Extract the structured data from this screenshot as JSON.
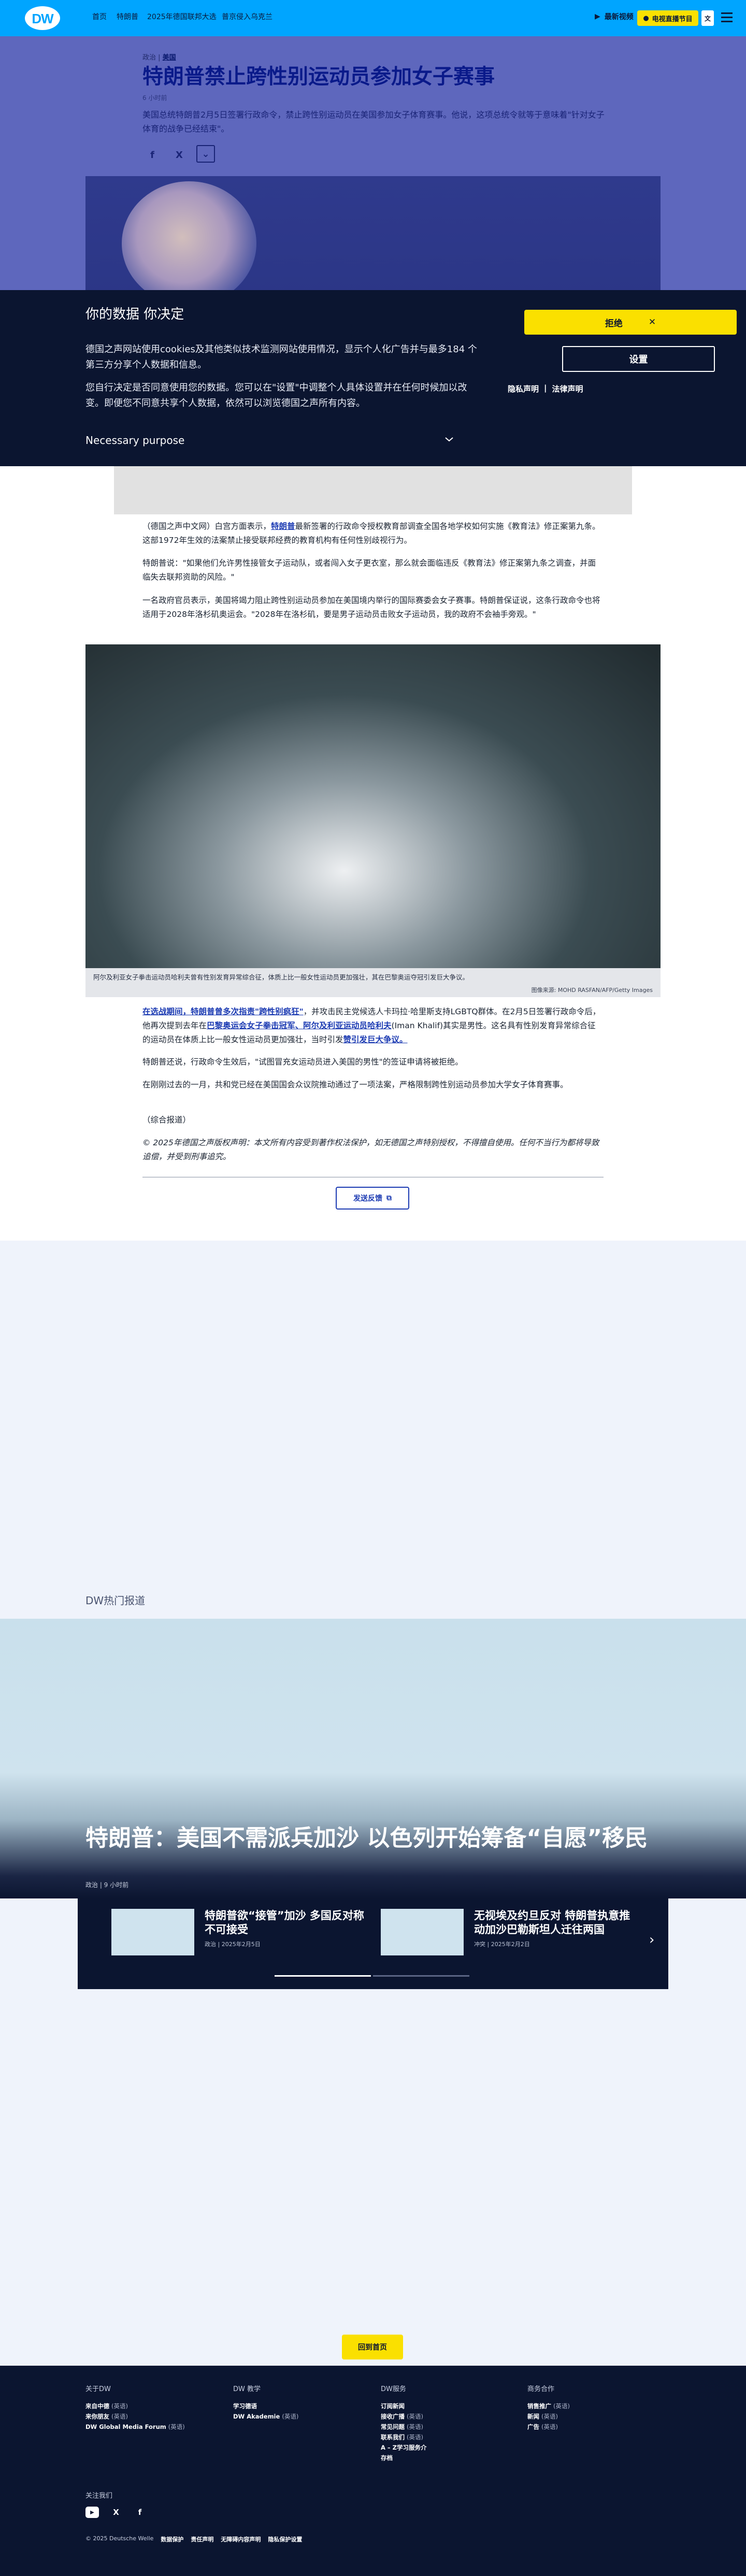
{
  "header": {
    "logo": "DW",
    "nav": [
      "首页",
      "特朗普",
      "2025年德国联邦大选",
      "普京侵入乌克兰"
    ],
    "latest": "最新视频",
    "live_label": "电视直播节目",
    "lang": "文"
  },
  "article": {
    "breadcrumb_prefix": "政治",
    "breadcrumb_section": "美国",
    "title": "特朗普禁止跨性别运动员参加女子赛事",
    "time": "6 小时前",
    "lead": "美国总统特朗普2月5日签署行政命令，禁止跨性别运动员在美国参加女子体育赛事。他说，这项总统令就等于意味着\"针对女子体育的战争已经结束\"。",
    "paragraphs": {
      "p1_a": "（德国之声中文网）白宫方面表示，",
      "p1_link": "特朗普",
      "p1_b": "最新签署的行政命令授权教育部调查全国各地学校如何实施《教育法》修正案第九条。这部1972年生效的法案禁止接受联邦经费的教育机构有任何性别歧视行为。",
      "p2": "特朗普说：\"如果他们允许男性接管女子运动队，或者闯入女子更衣室，那么就会面临违反《教育法》修正案第九条之调查，并面临失去联邦资助的风险。\"",
      "p3": "一名政府官员表示，美国将竭力阻止跨性别运动员参加在美国境内举行的国际赛委会女子赛事。特朗普保证说，这条行政命令也将适用于2028年洛杉矶奥运会。\"2028年在洛杉矶，要是男子运动员击败女子运动员，我的政府不会袖手旁观。\"",
      "p4_link1": "在选战期间，特朗普曾多次指责\"跨性别疯狂\"",
      "p4_a": "，并攻击民主党候选人卡玛拉·哈里斯支持LGBTQ群体。在2月5日签署行政命令后，他再次提到去年在",
      "p4_link2": "巴黎奥运会女子拳击冠军、阿尔及利亚运动员哈利夫",
      "p4_b": "(Iman Khalif)其实是男性。这名具有性别发育异常综合征的运动员在体质上比一般女性运动员更加强壮，当时引发",
      "p4_link3": "赞引发巨大争议。",
      "p5": "特朗普还说，行政命令生效后，\"试图冒充女运动员进入美国的男性\"的签证申请将被拒绝。",
      "p6": "在刚刚过去的一月，共和党已经在美国国会众议院推动通过了一项法案，严格限制跨性别运动员参加大学女子体育赛事。",
      "p7": "（综合报道）",
      "p8": "© 2025年德国之声版权声明：本文所有内容受到著作权法保护，如无德国之声特别授权，不得擅自使用。任何不当行为都将导致追偿，并受到刑事追究。"
    },
    "photo_caption": "阿尔及利亚女子拳击运动员哈利夫曾有性别发育异常综合征，体质上比一般女性运动员更加强壮，其在巴黎奥运夺冠引发巨大争议。",
    "photo_credit": "图像来源: MOHD RASFAN/AFP/Getty Images",
    "feedback": "发送反馈"
  },
  "consent": {
    "title": "你的数据 你决定",
    "p1": "德国之声网站使用cookies及其他类似技术监测网站使用情况，显示个人化广告并与最多184 个第三方分享个人数据和信息。",
    "p2": "您自行决定是否同意使用您的数据。您可以在\"设置\"中调整个人具体设置并在任何时候加以改变。即便您不同意共享个人数据，依然可以浏览德国之声所有内容。",
    "purpose": "Necessary purpose",
    "reject": "拒绝",
    "settings": "设置",
    "privacy": "隐私声明",
    "legal": "法律声明",
    "divider": "|"
  },
  "lower": {
    "section_label": "DW热门报道",
    "featured_title": "特朗普：美国不需派兵加沙 以色列开始筹备“自愿”移民",
    "featured_meta": "政治 | 9 小时前",
    "cards": [
      {
        "title": "特朗普欲“接管”加沙 多国反对称不可接受",
        "meta": "政治 | 2025年2月5日"
      },
      {
        "title": "无视埃及约旦反对 特朗普执意推动加沙巴勒斯坦人迁往两国",
        "meta": "冲突 | 2025年2月2日"
      }
    ],
    "next": "›",
    "back_top": "回到首页"
  },
  "footer": {
    "col1_title": "关于DW",
    "col1": [
      [
        "来自中德",
        "(英语)"
      ],
      [
        "来你朋友",
        "(英语)"
      ],
      [
        "DW Global Media Forum",
        "(英语)"
      ]
    ],
    "col2_title": "DW 教学",
    "col2": [
      [
        "学习德语",
        ""
      ],
      [
        "DW Akademie",
        "(英语)"
      ]
    ],
    "col3_title": "DW服务",
    "col3": [
      [
        "订阅新闻",
        ""
      ],
      [
        "接收广播",
        "(英语)"
      ],
      [
        "常见问题",
        "(英语)"
      ],
      [
        "联系我们",
        "(英语)"
      ],
      [
        "A – Z学习服务介",
        ""
      ],
      [
        "存档",
        ""
      ]
    ],
    "col4_title": "商务合作",
    "col4": [
      [
        "销售推广",
        "(英语)"
      ],
      [
        "新闻",
        "(英语)"
      ],
      [
        "广告",
        "(英语)"
      ]
    ],
    "follow": "关注我们",
    "social": [
      "▶",
      "X",
      "f"
    ],
    "copyright": "© 2025 Deutsche Welle",
    "links": [
      "数据保护",
      "责任声明",
      "无障碍内容声明",
      "隐私保护设置"
    ]
  },
  "colors": {
    "brand_blue": "#00a5ff",
    "accent_yellow": "#fae000",
    "navy": "#0b1530"
  }
}
